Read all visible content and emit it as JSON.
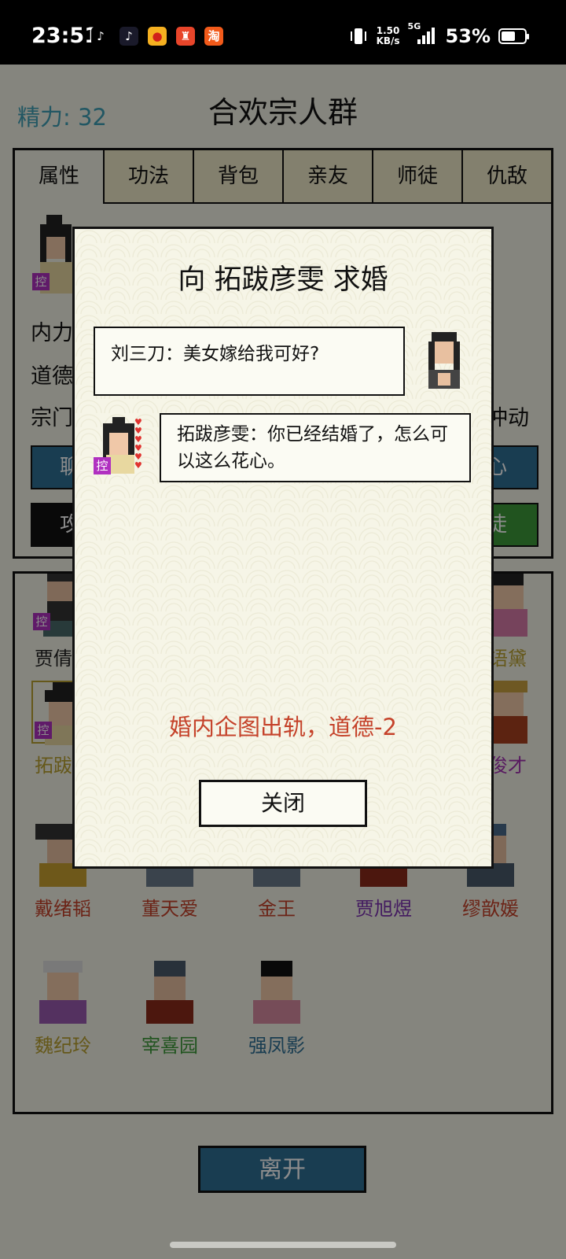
{
  "status_bar": {
    "time": "23:51",
    "speed_top": "1.50",
    "speed_bottom": "KB/s",
    "network": "5G",
    "battery": "53%"
  },
  "header": {
    "title": "合欢宗人群",
    "energy": "精力: 32"
  },
  "tabs": [
    "属性",
    "功法",
    "背包",
    "亲友",
    "师徒",
    "仇敌"
  ],
  "stats": {
    "neili": "内力",
    "daode": "道德",
    "zongmen": "宗门",
    "chongdong": "冲动"
  },
  "buttons": {
    "chat": "聊",
    "heart": "心",
    "attack": "攻",
    "disciple": "徒",
    "leave": "离开"
  },
  "tag": "控",
  "people": [
    {
      "name": "贾倩雯",
      "color": "#222222"
    },
    {
      "name": "语黛",
      "color": "#b8a030"
    },
    {
      "name": "拓跋彦",
      "color": "#b8a030"
    },
    {
      "name": "俊才",
      "color": "#a030b0"
    },
    {
      "name": "戴绪韬",
      "color": "#c5422a"
    },
    {
      "name": "董天爱",
      "color": "#c5422a"
    },
    {
      "name": "金王",
      "color": "#c5422a"
    },
    {
      "name": "贾旭煜",
      "color": "#7a30b0"
    },
    {
      "name": "缪歆媛",
      "color": "#c5422a"
    },
    {
      "name": "魏纪玲",
      "color": "#b8a030"
    },
    {
      "name": "宰喜园",
      "color": "#3c9a3a"
    },
    {
      "name": "强凤影",
      "color": "#2f6f94"
    }
  ],
  "dialog": {
    "title": "向 拓跋彦雯 求婚",
    "line1": "刘三刀：美女嫁给我可好?",
    "line2": "拓跋彦雯：你已经结婚了，怎么可以这么花心。",
    "result": "婚内企图出轨，道德-2",
    "close": "关闭"
  }
}
